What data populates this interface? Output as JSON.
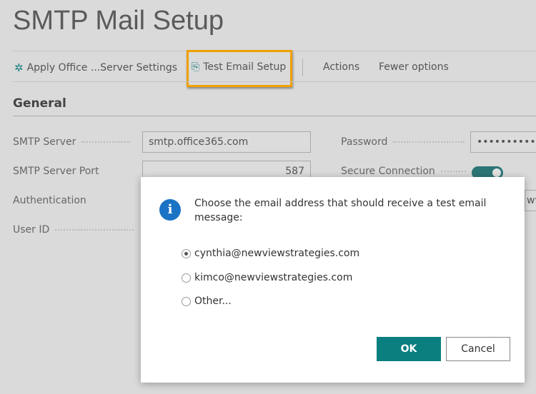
{
  "page": {
    "title": "SMTP Mail Setup"
  },
  "toolbar": {
    "apply": "Apply Office ...Server Settings",
    "test": "Test Email Setup",
    "actions": "Actions",
    "fewer": "Fewer options"
  },
  "section": "General",
  "fields": {
    "smtp_server": {
      "label": "SMTP Server",
      "value": "smtp.office365.com"
    },
    "smtp_port": {
      "label": "SMTP Server Port",
      "value": "587"
    },
    "authentication": {
      "label": "Authentication"
    },
    "user_id": {
      "label": "User ID"
    },
    "password": {
      "label": "Password",
      "value": "••••••••••"
    },
    "secure_connection": {
      "label": "Secure Connection",
      "value": true
    },
    "partial_value": "ww"
  },
  "dialog": {
    "icon": "info-icon",
    "message": "Choose the email address that should receive a test email message:",
    "options": [
      "cynthia@newviewstrategies.com",
      "kimco@newviewstrategies.com",
      "Other..."
    ],
    "selected": "cynthia@newviewstrategies.com",
    "ok": "OK",
    "cancel": "Cancel"
  },
  "colors": {
    "accent": "#0b7f7f",
    "highlight": "#f0a000",
    "info": "#1a73c4"
  }
}
